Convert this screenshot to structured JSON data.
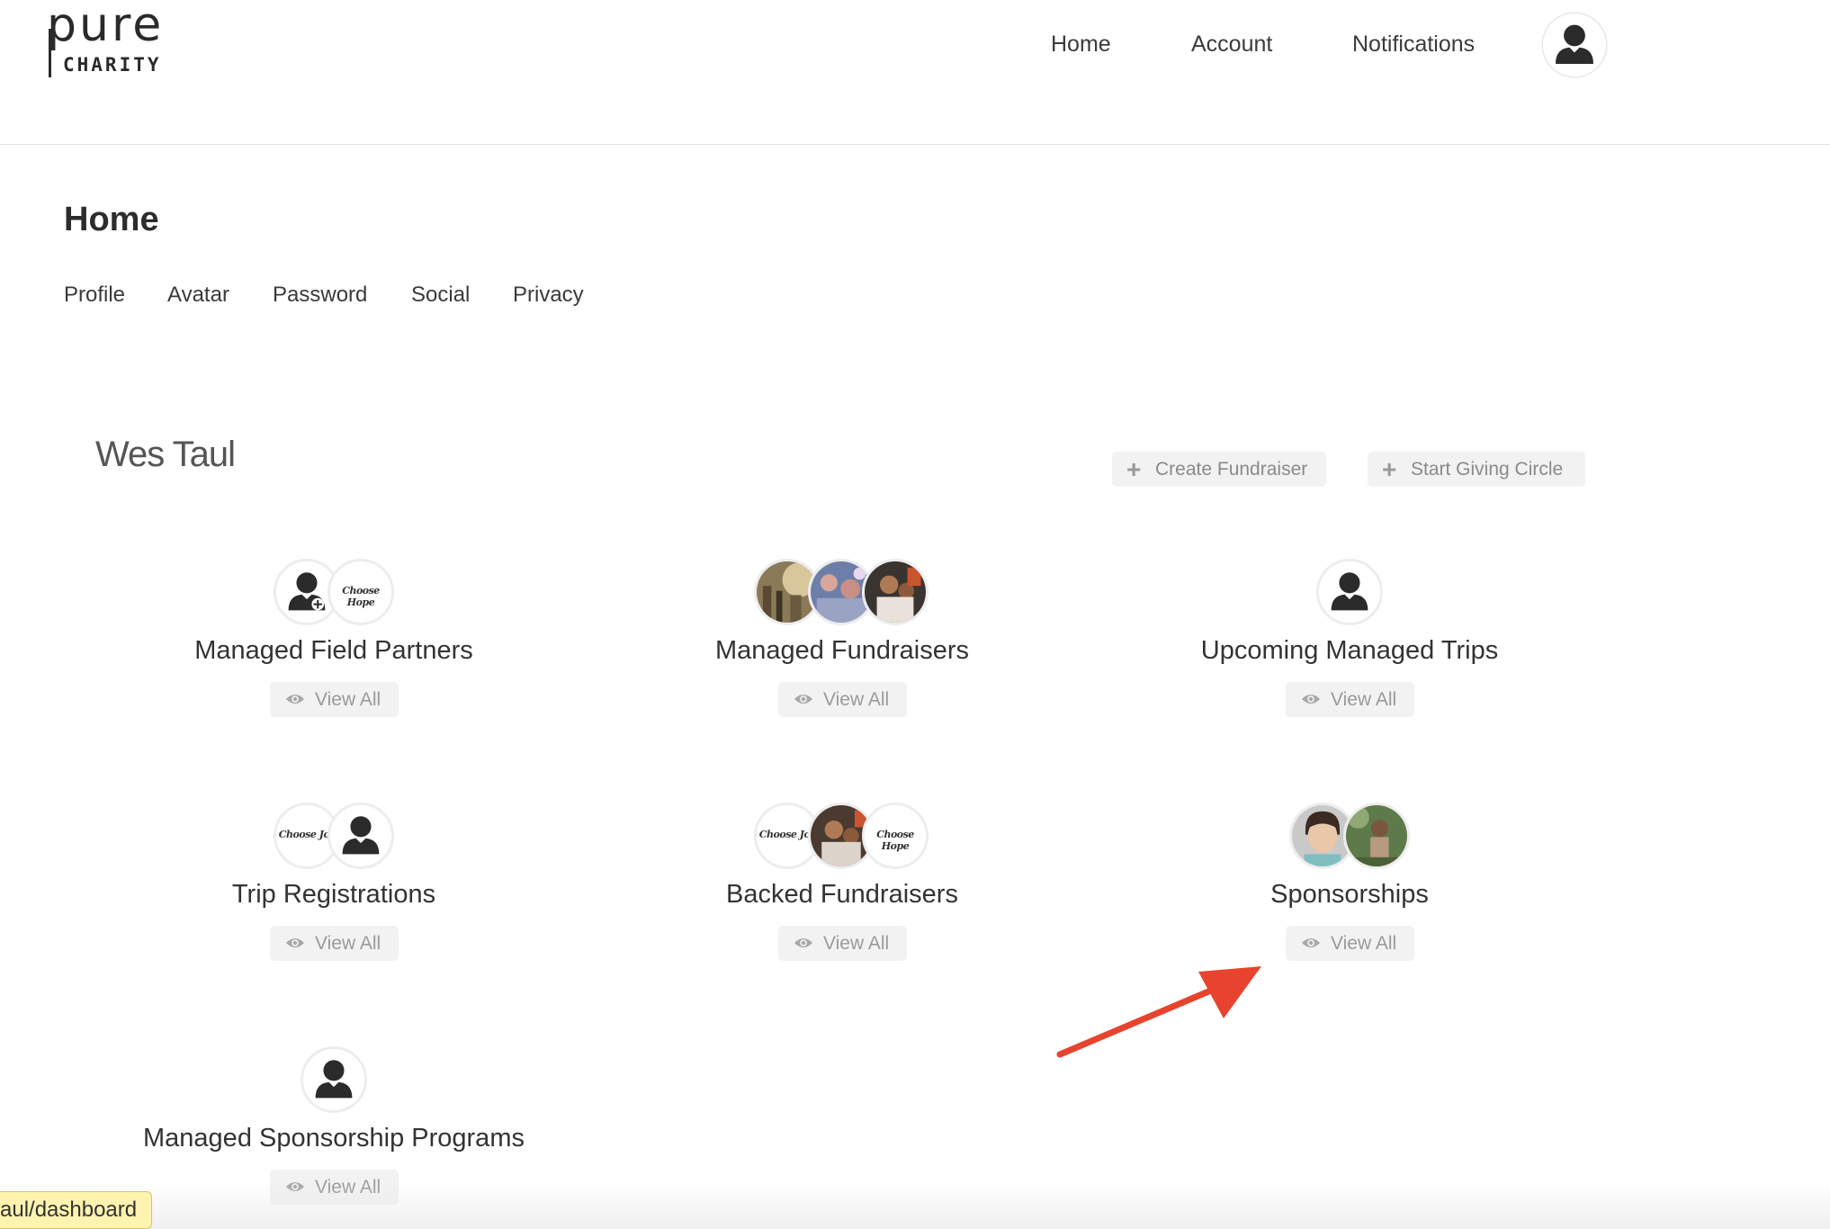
{
  "app": {
    "logo_word": "pure",
    "logo_sub": "CHARITY"
  },
  "topnav": {
    "home": "Home",
    "account": "Account",
    "notifications": "Notifications"
  },
  "page": {
    "title": "Home",
    "tabs": [
      "Profile",
      "Avatar",
      "Password",
      "Social",
      "Privacy"
    ]
  },
  "user": {
    "name": "Wes Taul"
  },
  "actions": {
    "create_fundraiser": "Create Fundraiser",
    "start_giving_circle": "Start Giving Circle"
  },
  "cards": [
    {
      "title": "Managed Field Partners",
      "view_all": "View All"
    },
    {
      "title": "Managed Fundraisers",
      "view_all": "View All"
    },
    {
      "title": "Upcoming Managed Trips",
      "view_all": "View All"
    },
    {
      "title": "Trip Registrations",
      "view_all": "View All"
    },
    {
      "title": "Backed Fundraisers",
      "view_all": "View All"
    },
    {
      "title": "Sponsorships",
      "view_all": "View All"
    },
    {
      "title": "Managed Sponsorship Programs",
      "view_all": "View All"
    }
  ],
  "logo_texts": {
    "choose_hope": "Choose Hope",
    "choose_joy": "Choose Joy"
  },
  "status_bar": {
    "url": "aul/dashboard"
  },
  "colors": {
    "annotation_arrow": "#e8432e",
    "button_bg": "#f2f2f2",
    "status_url_bg": "#fff3b0"
  },
  "icons": [
    "user-silhouette-icon",
    "plus-icon",
    "eye-icon"
  ]
}
